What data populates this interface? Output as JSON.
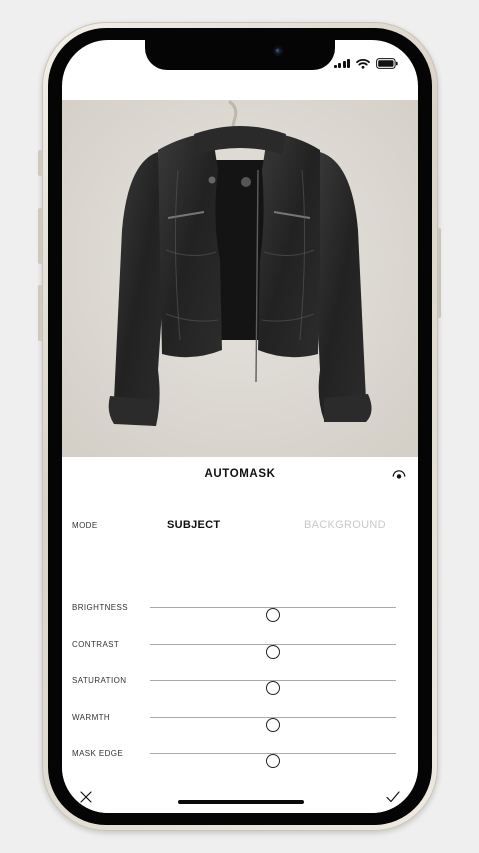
{
  "status_bar": {
    "signal_icon": "cellular-signal-icon",
    "wifi_icon": "wifi-icon",
    "battery_icon": "battery-icon"
  },
  "photo": {
    "subject": "black leather jacket on hanger"
  },
  "panel": {
    "title": "AUTOMASK",
    "visibility_icon": "eye-toggle-icon",
    "mode": {
      "label": "MODE",
      "options": [
        "SUBJECT",
        "BACKGROUND"
      ],
      "selected": "SUBJECT"
    },
    "sliders": [
      {
        "label": "BRIGHTNESS",
        "value": 0.5
      },
      {
        "label": "CONTRAST",
        "value": 0.5
      },
      {
        "label": "SATURATION",
        "value": 0.5
      },
      {
        "label": "WARMTH",
        "value": 0.5
      },
      {
        "label": "MASK EDGE",
        "value": 0.5
      }
    ],
    "actions": {
      "cancel_icon": "close-icon",
      "confirm_icon": "checkmark-icon"
    }
  },
  "colors": {
    "selected_mode": "#111111",
    "unselected_mode": "#c9c9c9",
    "slider_track": "#a9a9a9",
    "background": "#efefef"
  }
}
